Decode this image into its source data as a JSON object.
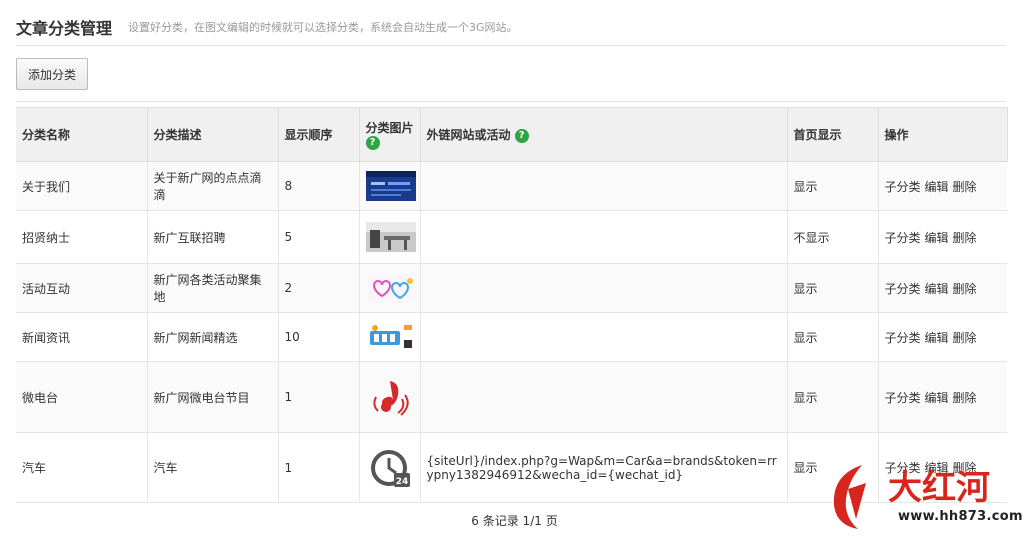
{
  "header": {
    "title": "文章分类管理",
    "subtitle": "设置好分类，在图文编辑的时候就可以选择分类，系统会自动生成一个3G网站。"
  },
  "toolbar": {
    "add_label": "添加分类"
  },
  "table": {
    "columns": [
      "分类名称",
      "分类描述",
      "显示顺序",
      "分类图片",
      "外链网站或活动",
      "首页显示",
      "操作"
    ],
    "help_glyph": "?",
    "rows": [
      {
        "name": "关于我们",
        "desc": "关于新广网的点点滴滴",
        "order": "8",
        "img": "blue-banner",
        "link": "",
        "home": "显示",
        "ops": [
          "子分类",
          "编辑",
          "删除"
        ]
      },
      {
        "name": "招贤纳士",
        "desc": "新广互联招聘",
        "order": "5",
        "img": "office-photo",
        "link": "",
        "home": "不显示",
        "ops": [
          "子分类",
          "编辑",
          "删除"
        ]
      },
      {
        "name": "活动互动",
        "desc": "新广网各类活动聚集地",
        "order": "2",
        "img": "hearts",
        "link": "",
        "home": "显示",
        "ops": [
          "子分类",
          "编辑",
          "删除"
        ]
      },
      {
        "name": "新闻资讯",
        "desc": "新广网新闻精选",
        "order": "10",
        "img": "news",
        "link": "",
        "home": "显示",
        "ops": [
          "子分类",
          "编辑",
          "删除"
        ]
      },
      {
        "name": "微电台",
        "desc": "新广网微电台节目",
        "order": "1",
        "img": "music-note",
        "link": "",
        "home": "显示",
        "ops": [
          "子分类",
          "编辑",
          "删除"
        ]
      },
      {
        "name": "汽车",
        "desc": "汽车",
        "order": "1",
        "img": "clock-24",
        "link": "{siteUrl}/index.php?g=Wap&m=Car&a=brands&token=rrypny1382946912&wecha_id={wechat_id}",
        "home": "显示",
        "ops": [
          "子分类",
          "编辑",
          "删除"
        ]
      }
    ]
  },
  "pager": {
    "text": "6 条记录 1/1 页"
  },
  "watermark": {
    "text": "www.hh873.com",
    "logo_chars": "大红河",
    "color": "#d7261e"
  }
}
